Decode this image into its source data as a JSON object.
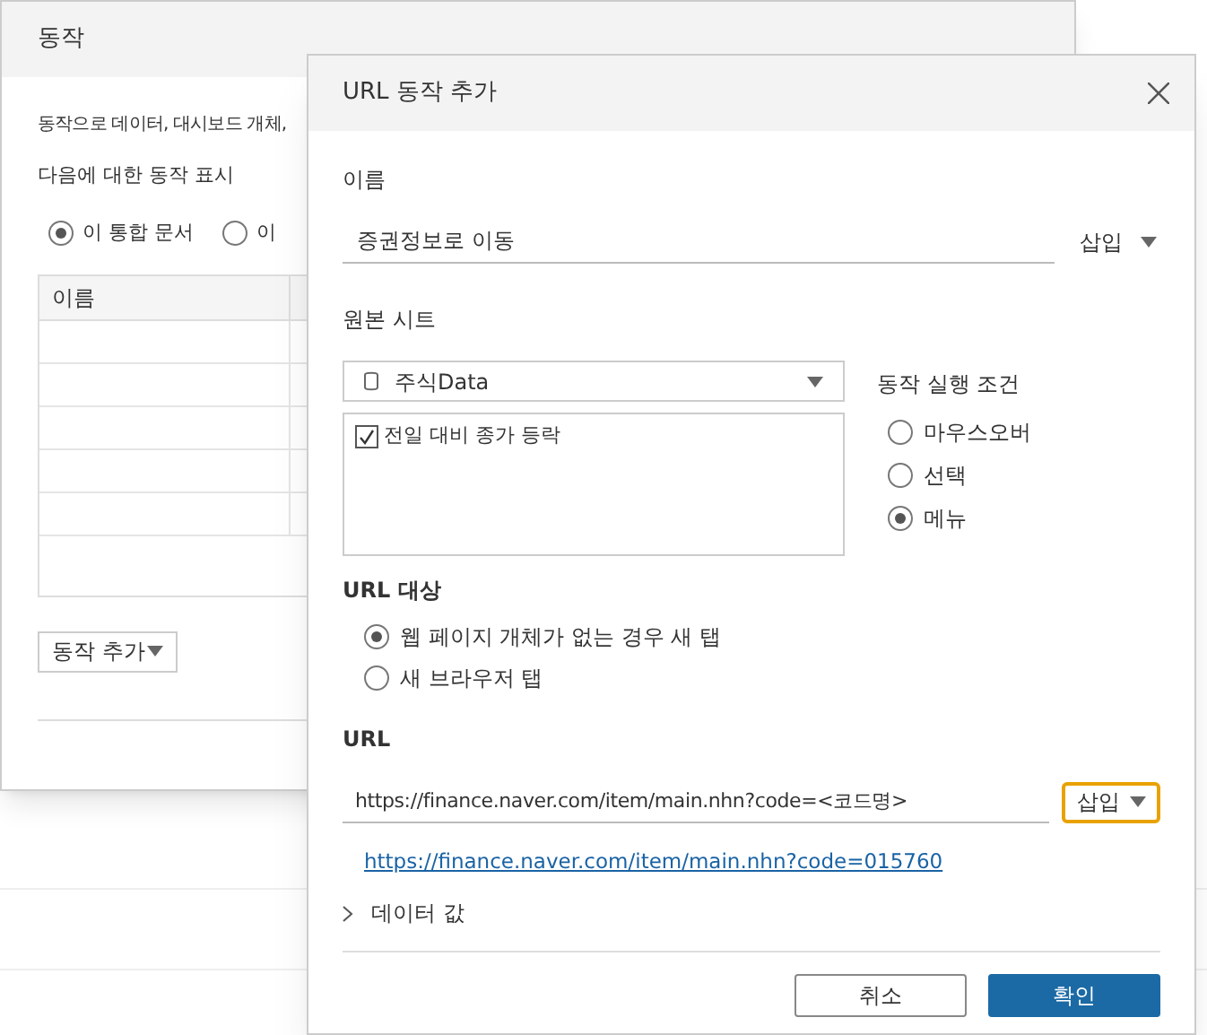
{
  "back_dialog": {
    "title": "동작",
    "description": "동작으로 데이터, 대시보드 개체,",
    "show_label": "다음에 대한 동작 표시",
    "scope_options": [
      {
        "label": "이 통합 문서",
        "selected": true
      },
      {
        "label": "이",
        "selected": false
      }
    ],
    "table": {
      "columns": [
        "이름"
      ]
    },
    "add_button": "동작 추가"
  },
  "dialog": {
    "title": "URL 동작 추가",
    "name_label": "이름",
    "name_value": "증권정보로 이동",
    "name_insert": "삽입",
    "source_label": "원본 시트",
    "source_value": "주식Data",
    "sheets": [
      {
        "label": "전일 대비 종가 등락",
        "checked": true
      }
    ],
    "run_label": "동작 실행 조건",
    "run_options": [
      {
        "label": "마우스오버",
        "selected": false
      },
      {
        "label": "선택",
        "selected": false
      },
      {
        "label": "메뉴",
        "selected": true
      }
    ],
    "target_label": "URL 대상",
    "target_options": [
      {
        "label": "웹 페이지 개체가 없는 경우 새 탭",
        "selected": true
      },
      {
        "label": "새 브라우저 탭",
        "selected": false
      }
    ],
    "url_label": "URL",
    "url_value": "https://finance.naver.com/item/main.nhn?code=<코드명>",
    "url_insert": "삽입",
    "url_preview": "https://finance.naver.com/item/main.nhn?code=015760",
    "data_values": {
      "label": "데이터 값",
      "expanded": false
    },
    "buttons": [
      {
        "label": "취소",
        "kind": "secondary"
      },
      {
        "label": "확인",
        "kind": "primary"
      }
    ]
  }
}
